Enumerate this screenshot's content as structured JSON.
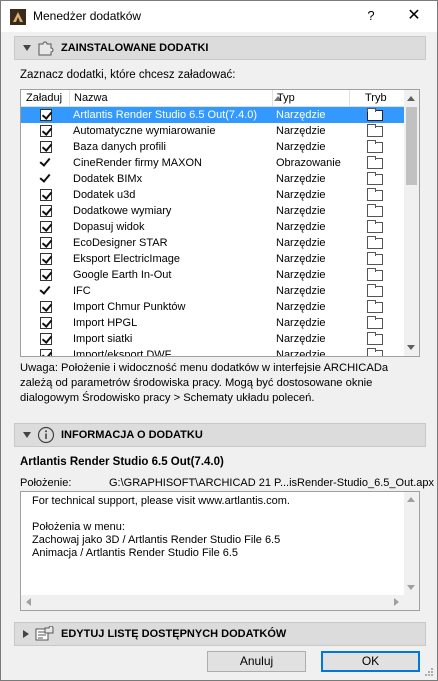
{
  "window": {
    "title": "Menedżer dodatków",
    "help_label": "?",
    "close_label": "✕"
  },
  "installed": {
    "header": "ZAINSTALOWANE DODATKI",
    "hint": "Zaznacz dodatki, które chcesz załadować:",
    "columns": {
      "load": "Załaduj",
      "name": "Nazwa",
      "type": "Typ",
      "mode": "Tryb"
    },
    "rows": [
      {
        "load": "checkbox",
        "name": "Artlantis Render Studio 6.5 Out(7.4.0)",
        "type": "Narzędzie",
        "selected": true
      },
      {
        "load": "checkbox",
        "name": "Automatyczne wymiarowanie",
        "type": "Narzędzie"
      },
      {
        "load": "checkbox",
        "name": "Baza danych profili",
        "type": "Narzędzie"
      },
      {
        "load": "tick",
        "name": "CineRender firmy MAXON",
        "type": "Obrazowanie"
      },
      {
        "load": "tick",
        "name": "Dodatek BIMx",
        "type": "Narzędzie"
      },
      {
        "load": "checkbox",
        "name": "Dodatek u3d",
        "type": "Narzędzie"
      },
      {
        "load": "checkbox",
        "name": "Dodatkowe wymiary",
        "type": "Narzędzie"
      },
      {
        "load": "checkbox",
        "name": "Dopasuj widok",
        "type": "Narzędzie"
      },
      {
        "load": "checkbox",
        "name": "EcoDesigner STAR",
        "type": "Narzędzie"
      },
      {
        "load": "checkbox",
        "name": "Eksport ElectricImage",
        "type": "Narzędzie"
      },
      {
        "load": "checkbox",
        "name": "Google Earth In-Out",
        "type": "Narzędzie"
      },
      {
        "load": "tick",
        "name": "IFC",
        "type": "Narzędzie"
      },
      {
        "load": "checkbox",
        "name": "Import Chmur Punktów",
        "type": "Narzędzie"
      },
      {
        "load": "checkbox",
        "name": "Import HPGL",
        "type": "Narzędzie"
      },
      {
        "load": "checkbox",
        "name": "Import siatki",
        "type": "Narzędzie"
      },
      {
        "load": "checkbox",
        "name": "Import/eksport DWF",
        "type": "Narzędzie"
      }
    ],
    "note": "Uwaga: Położenie i widoczność menu dodatków w interfejsie ARCHICADa zależą od parametrów środowiska pracy. Mogą być dostosowane oknie dialogowym Środowisko pracy > Schematy układu poleceń."
  },
  "info": {
    "header": "INFORMACJA O DODATKU",
    "addon_title": "Artlantis Render Studio 6.5 Out(7.4.0)",
    "location_label": "Położenie:",
    "location_value": "G:\\GRAPHISOFT\\ARCHICAD 21 P...isRender-Studio_6.5_Out.apx",
    "lines": [
      "For technical support, please visit www.artlantis.com.",
      "",
      "Położenia w menu:",
      "Zachowaj jako 3D / Artlantis Render Studio File 6.5",
      "Animacja / Artlantis Render Studio File 6.5"
    ]
  },
  "edit": {
    "header": "EDYTUJ LISTĘ DOSTĘPNYCH DODATKÓW"
  },
  "buttons": {
    "cancel": "Anuluj",
    "ok": "OK"
  }
}
